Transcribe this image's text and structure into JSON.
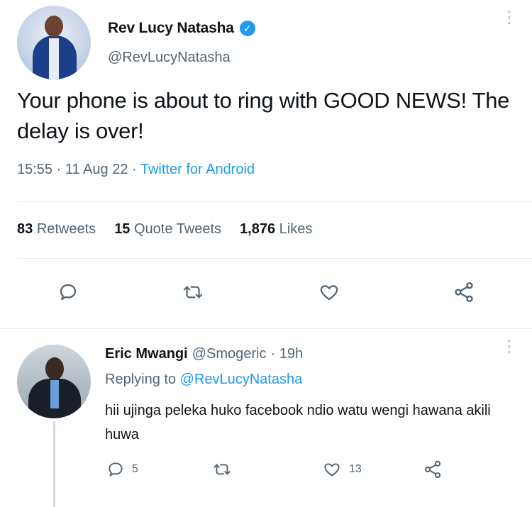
{
  "tweet": {
    "display_name": "Rev Lucy Natasha",
    "verified_icon": "verified-badge-icon",
    "verified_glyph": "✓",
    "handle": "@RevLucyNatasha",
    "more_glyph": "⋮",
    "text": "Your phone is about to ring with GOOD NEWS! The delay is over!",
    "time": "15:55",
    "sep1": " · ",
    "date": "11 Aug 22",
    "sep2": " · ",
    "source": "Twitter for Android",
    "stats": {
      "retweets_count": "83",
      "retweets_label": "Retweets",
      "quotes_count": "15",
      "quotes_label": "Quote Tweets",
      "likes_count": "1,876",
      "likes_label": "Likes"
    },
    "actions": [
      "reply-icon",
      "retweet-icon",
      "like-icon",
      "share-icon"
    ]
  },
  "reply": {
    "display_name": "Eric Mwangi",
    "handle": "@Smogeric",
    "time": "· 19h",
    "more_glyph": "⋮",
    "replying_prefix": "Replying to",
    "replying_to": "@RevLucyNatasha",
    "text": "hii ujinga peleka huko facebook ndio watu wengi hawana akili huwa",
    "reply_count": "5",
    "like_count": "13"
  },
  "colors": {
    "accent": "#1d9bf0",
    "text": "#0f1419",
    "secondary": "#536471",
    "divider": "#e6ecf0"
  }
}
